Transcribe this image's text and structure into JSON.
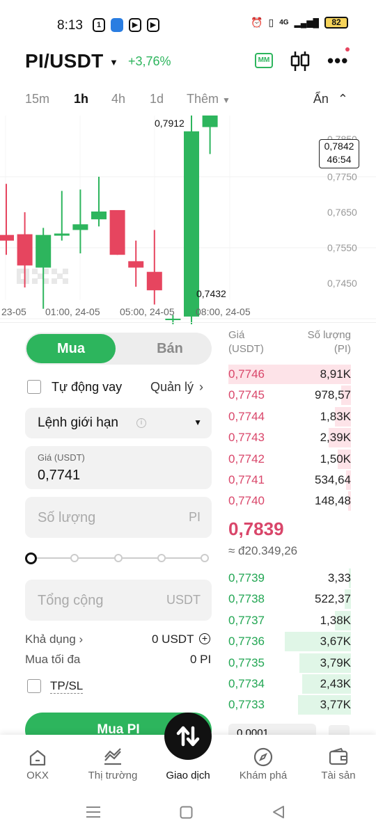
{
  "status_bar": {
    "time": "8:13",
    "network": "4G",
    "battery": "82"
  },
  "header": {
    "pair": "PI/USDT",
    "change": "+3,76%",
    "mm_label": "MM"
  },
  "intervals": {
    "items": [
      "15m",
      "1h",
      "4h",
      "1d"
    ],
    "more": "Thêm",
    "hide": "Ẩn"
  },
  "chart": {
    "y_ticks": [
      "0,7850",
      "0,7750",
      "0,7650",
      "0,7550",
      "0,7450"
    ],
    "x_ticks": [
      "23-05",
      "01:00, 24-05",
      "05:00, 24-05",
      "08:00, 24-05"
    ],
    "high_label": "0,7912",
    "low_label": "0,7432",
    "last_price": "0,7842",
    "countdown": "46:54",
    "watermark": "OKX"
  },
  "chart_data": {
    "type": "candlestick",
    "interval": "1h",
    "ylim": [
      0.742,
      0.792
    ],
    "x_ticks": [
      "23-05",
      "01:00, 24-05",
      "05:00, 24-05",
      "08:00, 24-05"
    ],
    "candles": [
      {
        "open": 0.7668,
        "close": 0.766,
        "high": 0.774,
        "low": 0.764
      },
      {
        "open": 0.7669,
        "close": 0.7625,
        "high": 0.77,
        "low": 0.7594
      },
      {
        "open": 0.7622,
        "close": 0.7668,
        "high": 0.7678,
        "low": 0.7564
      },
      {
        "open": 0.7667,
        "close": 0.767,
        "high": 0.773,
        "low": 0.766
      },
      {
        "open": 0.7675,
        "close": 0.7683,
        "high": 0.7732,
        "low": 0.7642
      },
      {
        "open": 0.769,
        "close": 0.7701,
        "high": 0.775,
        "low": 0.768
      },
      {
        "open": 0.7703,
        "close": 0.764,
        "high": 0.7703,
        "low": 0.764
      },
      {
        "open": 0.7631,
        "close": 0.7622,
        "high": 0.766,
        "low": 0.7595
      },
      {
        "open": 0.7616,
        "close": 0.759,
        "high": 0.7675,
        "low": 0.757
      },
      {
        "open": 0.7548,
        "close": 0.755,
        "high": 0.7555,
        "low": 0.7432
      },
      {
        "open": 0.7553,
        "close": 0.7814,
        "high": 0.784,
        "low": 0.754
      },
      {
        "open": 0.782,
        "close": 0.7842,
        "high": 0.7912,
        "low": 0.7782
      }
    ]
  },
  "trade": {
    "buy_tab": "Mua",
    "sell_tab": "Bán",
    "auto_borrow": "Tự động vay",
    "manage": "Quản lý",
    "order_type": "Lệnh giới hạn",
    "price_label": "Giá (USDT)",
    "price_value": "0,7741",
    "qty_placeholder": "Số lượng",
    "qty_unit": "PI",
    "total_placeholder": "Tổng cộng",
    "total_unit": "USDT",
    "available_label": "Khả dụng",
    "available_value": "0 USDT",
    "max_buy_label": "Mua tối đa",
    "max_buy_value": "0 PI",
    "tpsl_label": "TP/SL",
    "buy_button": "Mua PI"
  },
  "orderbook": {
    "price_header": "Giá",
    "price_unit": "(USDT)",
    "qty_header": "Số lượng",
    "qty_unit": "(PI)",
    "asks": [
      {
        "price": "0,7746",
        "qty": "8,91K",
        "depth": 1.0
      },
      {
        "price": "0,7745",
        "qty": "978,57",
        "depth": 0.08
      },
      {
        "price": "0,7744",
        "qty": "1,83K",
        "depth": 0.13
      },
      {
        "price": "0,7743",
        "qty": "2,39K",
        "depth": 0.18
      },
      {
        "price": "0,7742",
        "qty": "1,50K",
        "depth": 0.11
      },
      {
        "price": "0,7741",
        "qty": "534,64",
        "depth": 0.04
      },
      {
        "price": "0,7740",
        "qty": "148,48",
        "depth": 0.02
      }
    ],
    "last_price": "0,7839",
    "fiat_price": "≈ đ20.349,26",
    "bids": [
      {
        "price": "0,7739",
        "qty": "3,33",
        "depth": 0.01
      },
      {
        "price": "0,7738",
        "qty": "522,37",
        "depth": 0.05
      },
      {
        "price": "0,7737",
        "qty": "1,38K",
        "depth": 0.13
      },
      {
        "price": "0,7736",
        "qty": "3,67K",
        "depth": 0.54
      },
      {
        "price": "0,7735",
        "qty": "3,79K",
        "depth": 0.42
      },
      {
        "price": "0,7734",
        "qty": "2,43K",
        "depth": 0.4
      },
      {
        "price": "0,7733",
        "qty": "3,77K",
        "depth": 0.43
      }
    ],
    "step": "0,0001"
  },
  "bottom_nav": {
    "items": [
      {
        "label": "OKX",
        "icon": "home-icon"
      },
      {
        "label": "Thị trường",
        "icon": "market-chart-icon"
      },
      {
        "label": "Giao dịch",
        "icon": "trade-swap-icon"
      },
      {
        "label": "Khám phá",
        "icon": "compass-icon"
      },
      {
        "label": "Tài sản",
        "icon": "wallet-icon"
      }
    ]
  },
  "colors": {
    "green": "#2db55d",
    "red": "#d9466a",
    "candle_red": "#e6455f"
  }
}
